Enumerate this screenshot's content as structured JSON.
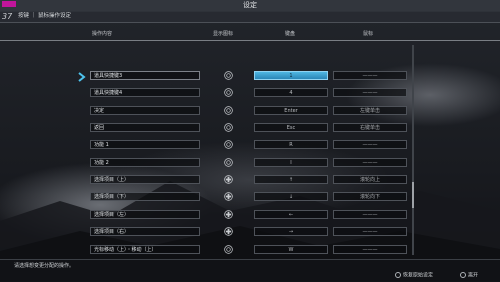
{
  "window": {
    "title": "设定"
  },
  "breadcrumb": {
    "number": "37",
    "path": "按键 ｜ 鼠标操作设定"
  },
  "columns": {
    "action": "操作内容",
    "icon": "显示图标",
    "keyboard": "键盘",
    "mouse": "鼠标"
  },
  "rows": [
    {
      "name": "道具快捷键3",
      "icon": "circle-icon",
      "keyboard": "1",
      "mouse": "———"
    },
    {
      "name": "道具快捷键4",
      "icon": "circle-icon",
      "keyboard": "4",
      "mouse": "———"
    },
    {
      "name": "决定",
      "icon": "circle-icon",
      "keyboard": "Enter",
      "mouse": "左键单击"
    },
    {
      "name": "返回",
      "icon": "circle-icon",
      "keyboard": "Esc",
      "mouse": "右键单击"
    },
    {
      "name": "功能 1",
      "icon": "circle-icon",
      "keyboard": "R",
      "mouse": "———"
    },
    {
      "name": "功能 2",
      "icon": "circle-icon",
      "keyboard": "I",
      "mouse": "———"
    },
    {
      "name": "选择项目（上）",
      "icon": "dpad-icon",
      "keyboard": "↑",
      "mouse": "滚轮向上"
    },
    {
      "name": "选择项目（下）",
      "icon": "dpad-icon",
      "keyboard": "↓",
      "mouse": "滚轮向下"
    },
    {
      "name": "选择项目（左）",
      "icon": "dpad-icon",
      "keyboard": "←",
      "mouse": "———"
    },
    {
      "name": "选择项目（右）",
      "icon": "dpad-icon",
      "keyboard": "→",
      "mouse": "———"
    },
    {
      "name": "光标移动（上）・移动（上）",
      "icon": "circle-icon",
      "keyboard": "W",
      "mouse": "———"
    }
  ],
  "selected_row": 0,
  "footer": {
    "hint": "请选择想变更分配的操作。",
    "restore_label": "恢复原始设定",
    "back_label": "离开"
  },
  "colors": {
    "accent": "#3ba3d4",
    "highlight_pink": "#c2159b"
  }
}
